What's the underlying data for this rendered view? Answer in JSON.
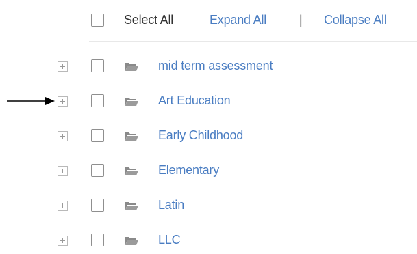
{
  "header": {
    "select_all_label": "Select All",
    "expand_all_label": "Expand All",
    "separator": "|",
    "collapse_all_label": "Collapse All"
  },
  "tree": {
    "items": [
      {
        "label": "mid term assessment",
        "icon": "folder-icon",
        "toggle": "plus-icon"
      },
      {
        "label": "Art Education",
        "icon": "folder-icon",
        "toggle": "plus-icon"
      },
      {
        "label": "Early Childhood",
        "icon": "folder-icon",
        "toggle": "plus-icon"
      },
      {
        "label": "Elementary",
        "icon": "folder-icon",
        "toggle": "plus-icon"
      },
      {
        "label": "Latin",
        "icon": "folder-icon",
        "toggle": "plus-icon"
      },
      {
        "label": "LLC",
        "icon": "folder-icon",
        "toggle": "plus-icon"
      }
    ]
  },
  "annotation": {
    "icon": "arrow-right-icon",
    "points_to": "Art Education"
  },
  "colors": {
    "link": "#4a7dc2",
    "text": "#333333",
    "folder": "#8a8a8a",
    "checkbox_border": "#8f8f8f",
    "toggle_border": "#b9b9b9",
    "arrow": "#000000"
  }
}
